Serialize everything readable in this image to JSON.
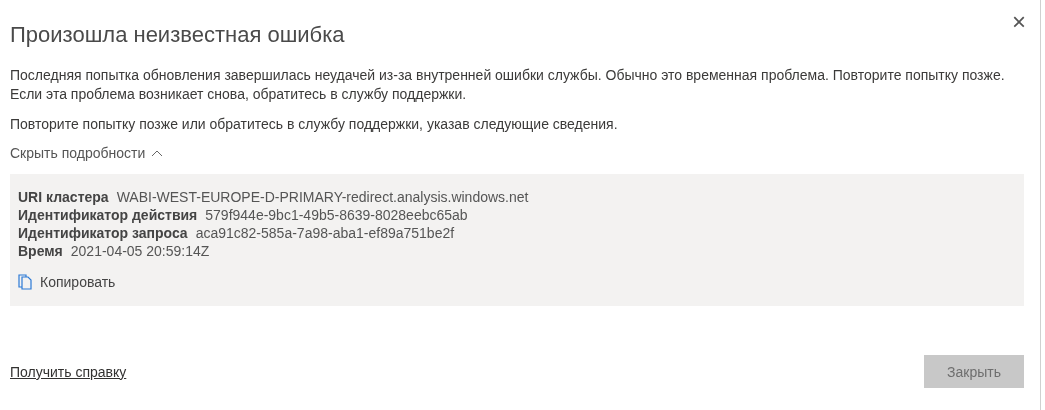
{
  "dialog": {
    "title": "Произошла неизвестная ошибка",
    "close": "×",
    "message": [
      "Последняя попытка обновления завершилась неудачей из-за внутренней ошибки службы. Обычно это временная проблема. Повторите попытку позже. Если эта проблема возникает снова, обратитесь в службу поддержки.",
      "Повторите попытку позже или обратитесь в службу поддержки, указав следующие сведения."
    ],
    "details_toggle": {
      "label": "Скрыть подробности",
      "expanded": true
    },
    "details": [
      {
        "label": "URI кластера",
        "value": "WABI-WEST-EUROPE-D-PRIMARY-redirect.analysis.windows.net"
      },
      {
        "label": "Идентификатор действия",
        "value": "579f944e-9bc1-49b5-8639-8028eebc65ab"
      },
      {
        "label": "Идентификатор запроса",
        "value": "aca91c82-585a-7a98-aba1-ef89a751be2f"
      },
      {
        "label": "Время",
        "value": "2021-04-05 20:59:14Z"
      }
    ],
    "copy_button": "Копировать",
    "help_link": "Получить справку",
    "close_button": "Закрыть"
  }
}
